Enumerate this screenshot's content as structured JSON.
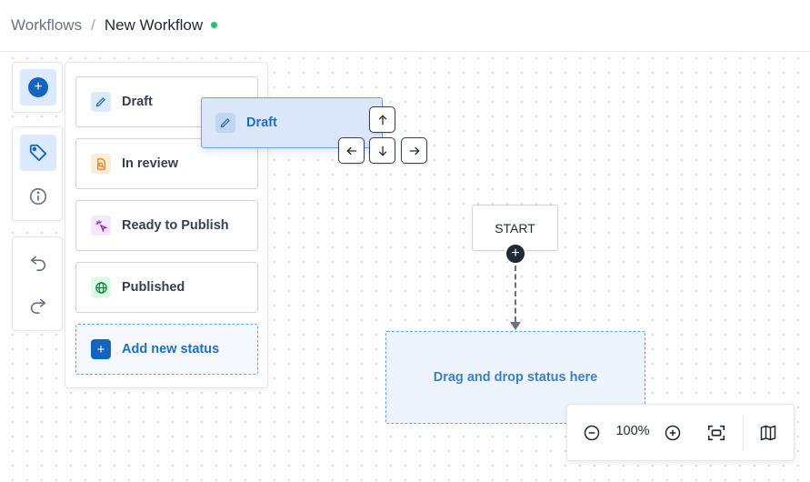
{
  "breadcrumb": {
    "root": "Workflows",
    "separator": "/",
    "current": "New Workflow",
    "status_color": "#22c55e"
  },
  "toolbar": {
    "groups": [
      {
        "tools": [
          {
            "icon": "add-icon",
            "active": true
          }
        ]
      },
      {
        "tools": [
          {
            "icon": "tag-icon",
            "active": true
          },
          {
            "icon": "info-icon",
            "active": false
          }
        ]
      },
      {
        "tools": [
          {
            "icon": "undo-icon",
            "active": false
          },
          {
            "icon": "redo-icon",
            "active": false
          }
        ]
      }
    ]
  },
  "status_panel": {
    "items": [
      {
        "label": "Draft",
        "icon": "pencil-icon",
        "color": "#1d6fc4"
      },
      {
        "label": "In review",
        "icon": "document-search-icon",
        "color": "#ea7b16"
      },
      {
        "label": "Ready to Publish",
        "icon": "sparkle-cursor-icon",
        "color": "#a21caf"
      },
      {
        "label": "Published",
        "icon": "globe-icon",
        "color": "#15803d"
      }
    ],
    "add_label": "Add new status"
  },
  "drag_preview": {
    "label": "Draft",
    "icon": "pencil-icon",
    "keys": [
      "arrow-up-icon",
      "arrow-left-icon",
      "arrow-down-icon",
      "arrow-right-icon"
    ]
  },
  "canvas": {
    "start_label": "START",
    "drop_zone_label": "Drag and drop status here"
  },
  "zoom": {
    "level": "100%",
    "controls": [
      "zoom-out-icon",
      "zoom-in-icon",
      "fit-view-icon",
      "map-icon"
    ]
  },
  "colors": {
    "accent": "#1565c0",
    "drop_border": "#60a5fa"
  }
}
